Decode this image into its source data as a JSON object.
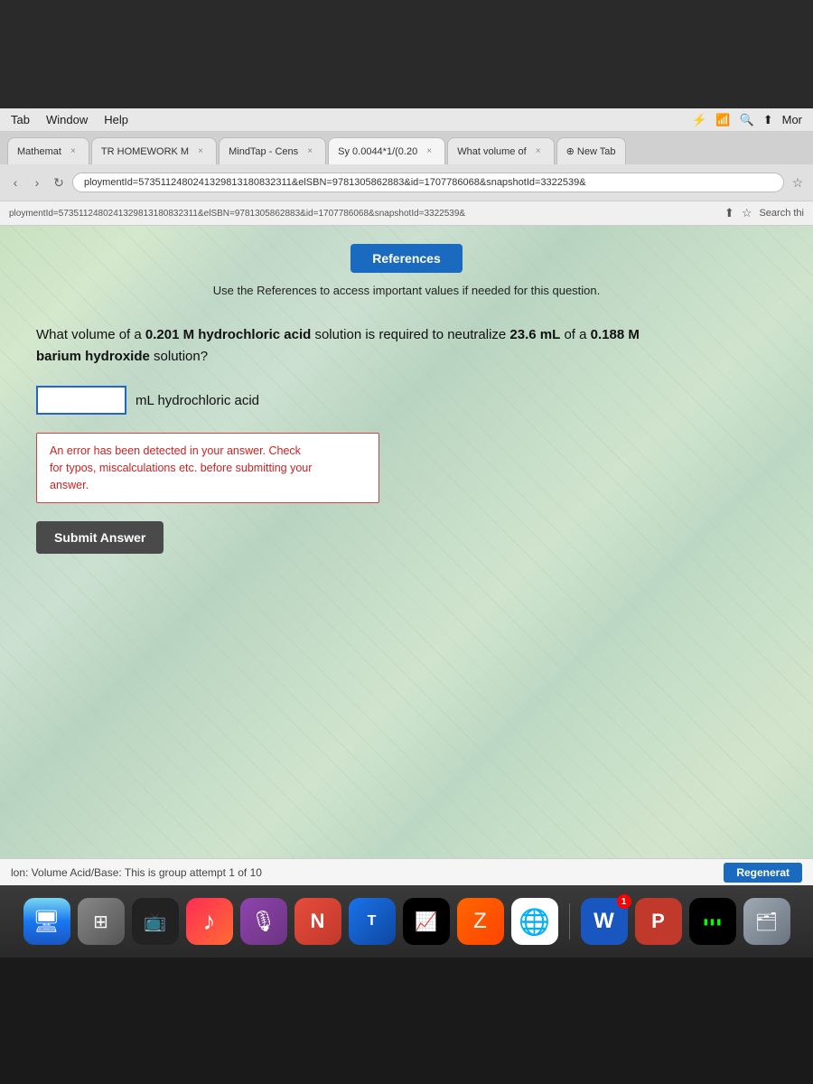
{
  "topDark": {
    "height": 120
  },
  "menuBar": {
    "items": [
      "Tab",
      "Window",
      "Help"
    ],
    "rightIcons": [
      "battery-icon",
      "wifi-icon",
      "search-icon",
      "share-icon",
      "more-icon"
    ],
    "moreLabel": "Mor"
  },
  "tabs": [
    {
      "id": "tab-math",
      "label": "Mathemat",
      "active": false,
      "closable": true
    },
    {
      "id": "tab-homework",
      "label": "TR HOMEWORK M",
      "active": false,
      "closable": true
    },
    {
      "id": "tab-mindtap",
      "label": "MindTap - Cens",
      "active": false,
      "closable": true
    },
    {
      "id": "tab-sy",
      "label": "Sy 0.0044*1/(0.20",
      "active": true,
      "closable": true
    },
    {
      "id": "tab-volume",
      "label": "What volume of",
      "active": false,
      "closable": true
    },
    {
      "id": "tab-newtab",
      "label": "New Tab",
      "active": false,
      "closable": false
    }
  ],
  "addressBar": {
    "url": "ploymentId=5735112480241329813180832311&elSBN=9781305862883&id=1707786068&snapshotId=3322539&",
    "searchPlaceholder": "Search thi"
  },
  "referencesButton": {
    "label": "References"
  },
  "referencesSub": {
    "text": "Use the References to access important values if needed for this question."
  },
  "question": {
    "text": "What volume of a 0.201 M hydrochloric acid solution is required to neutralize 23.6 mL of a 0.188 M barium hydroxide solution?",
    "boldParts": [
      "0.201 M",
      "hydrochloric acid",
      "23.6 mL",
      "0.188",
      "barium hydroxide"
    ],
    "inputValue": "",
    "inputPlaceholder": "",
    "unit": "mL hydrochloric acid"
  },
  "errorBox": {
    "line1": "An error has been detected in your answer. Check",
    "line2": "for typos, miscalculations etc. before submitting your",
    "line3": "answer."
  },
  "submitButton": {
    "label": "Submit Answer"
  },
  "statusBar": {
    "text": "lon: Volume Acid/Base: This is group attempt 1 of 10",
    "regenerateLabel": "Regenerat"
  },
  "dock": {
    "icons": [
      {
        "id": "finder",
        "symbol": "🔵",
        "label": "Finder"
      },
      {
        "id": "launchpad",
        "symbol": "⊞",
        "label": "Launchpad"
      },
      {
        "id": "tv",
        "symbol": "📺",
        "label": "TV"
      },
      {
        "id": "music",
        "symbol": "♪",
        "label": "Music"
      },
      {
        "id": "podcast",
        "symbol": "🎙",
        "label": "Podcasts"
      },
      {
        "id": "news",
        "symbol": "N",
        "label": "News"
      },
      {
        "id": "translate",
        "symbol": "T",
        "label": "Translate"
      },
      {
        "id": "stocks",
        "symbol": "↗",
        "label": "Stocks"
      },
      {
        "id": "notes",
        "symbol": "Z",
        "label": "Notes"
      },
      {
        "id": "chrome",
        "symbol": "◎",
        "label": "Chrome"
      },
      {
        "id": "word",
        "symbol": "W",
        "label": "Word",
        "badge": "1"
      },
      {
        "id": "pp",
        "symbol": "P",
        "label": "PowerPoint"
      },
      {
        "id": "terminal",
        "symbol": "▮▮",
        "label": "Terminal"
      },
      {
        "id": "finder2",
        "symbol": "⬜",
        "label": "Finder Window"
      }
    ]
  }
}
